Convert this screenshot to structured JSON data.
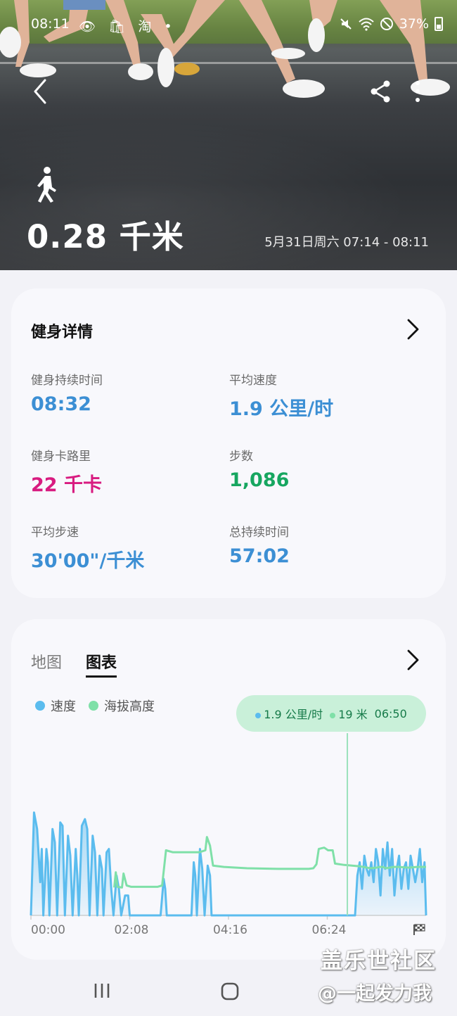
{
  "status_bar": {
    "time": "08:11",
    "left_icons": "👁 🛍 淘 •",
    "battery_text": "37%"
  },
  "hero": {
    "distance": "0.28 千米",
    "date_range": "5月31日周六 07:14 - 08:11"
  },
  "details": {
    "title": "健身详情",
    "metrics": [
      {
        "label": "健身持续时间",
        "value": "08:32"
      },
      {
        "label": "平均速度",
        "value": "1.9 公里/时"
      },
      {
        "label": "健身卡路里",
        "value": "22 千卡"
      },
      {
        "label": "步数",
        "value": "1,086"
      },
      {
        "label": "平均步速",
        "value": "30'00\"/千米"
      },
      {
        "label": "总持续时间",
        "value": "57:02"
      }
    ]
  },
  "chart_card": {
    "tabs": [
      {
        "label": "地图",
        "active": false
      },
      {
        "label": "图表",
        "active": true
      }
    ],
    "legend": [
      {
        "label": "速度",
        "color": "#5bbcee"
      },
      {
        "label": "海拔高度",
        "color": "#7fe0a8"
      }
    ],
    "tooltip": {
      "speed": "1.9 公里/时",
      "altitude": "19 米",
      "time": "06:50"
    }
  },
  "chart_data": {
    "type": "line",
    "x_ticks": [
      "00:00",
      "02:08",
      "04:16",
      "06:24"
    ],
    "x_range_seconds": [
      0,
      512
    ],
    "series": [
      {
        "name": "速度",
        "color": "#5bbcee",
        "points": [
          [
            0,
            0
          ],
          [
            4,
            1.55
          ],
          [
            8,
            1.3
          ],
          [
            12,
            0.5
          ],
          [
            14,
            1.0
          ],
          [
            16,
            0
          ],
          [
            20,
            1.0
          ],
          [
            22,
            0.8
          ],
          [
            24,
            0
          ],
          [
            28,
            1.3
          ],
          [
            31,
            1.1
          ],
          [
            34,
            0
          ],
          [
            38,
            1.4
          ],
          [
            41,
            1.35
          ],
          [
            44,
            0
          ],
          [
            48,
            1.2
          ],
          [
            51,
            0.9
          ],
          [
            54,
            0
          ],
          [
            58,
            1.0
          ],
          [
            60,
            0.6
          ],
          [
            62,
            0
          ],
          [
            66,
            1.35
          ],
          [
            70,
            1.45
          ],
          [
            73,
            1.3
          ],
          [
            76,
            0
          ],
          [
            80,
            1.2
          ],
          [
            83,
            0.95
          ],
          [
            86,
            0
          ],
          [
            89,
            0.9
          ],
          [
            92,
            0.7
          ],
          [
            94,
            0
          ],
          [
            98,
            0.95
          ],
          [
            101,
            1.0
          ],
          [
            104,
            0.4
          ],
          [
            107,
            0
          ],
          [
            111,
            0.6
          ],
          [
            114,
            0.4
          ],
          [
            117,
            0
          ],
          [
            122,
            0.3
          ],
          [
            126,
            0.3
          ],
          [
            128,
            0
          ],
          [
            168,
            0
          ],
          [
            172,
            0.55
          ],
          [
            174,
            0.4
          ],
          [
            176,
            0
          ],
          [
            208,
            0
          ],
          [
            211,
            0.8
          ],
          [
            213,
            0.6
          ],
          [
            215,
            0
          ],
          [
            219,
            1.0
          ],
          [
            222,
            0.7
          ],
          [
            225,
            0
          ],
          [
            229,
            0.75
          ],
          [
            232,
            0.6
          ],
          [
            234,
            0
          ],
          [
            420,
            0
          ],
          [
            423,
            0.6
          ],
          [
            426,
            0.8
          ],
          [
            429,
            0.4
          ],
          [
            432,
            0.9
          ],
          [
            435,
            0.7
          ],
          [
            438,
            0.6
          ],
          [
            441,
            0.8
          ],
          [
            444,
            0.5
          ],
          [
            447,
            1.0
          ],
          [
            450,
            0.8
          ],
          [
            453,
            0.3
          ],
          [
            456,
            1.0
          ],
          [
            459,
            0.7
          ],
          [
            462,
            1.1
          ],
          [
            465,
            0.6
          ],
          [
            468,
            1.0
          ],
          [
            471,
            0.3
          ],
          [
            474,
            0.7
          ],
          [
            477,
            0.9
          ],
          [
            480,
            0.4
          ],
          [
            483,
            0.7
          ],
          [
            486,
            0.8
          ],
          [
            489,
            0.4
          ],
          [
            492,
            0.9
          ],
          [
            495,
            0.7
          ],
          [
            498,
            0.5
          ],
          [
            501,
            0.7
          ],
          [
            504,
            1.0
          ],
          [
            507,
            0.5
          ],
          [
            510,
            0.8
          ],
          [
            512,
            0
          ]
        ]
      },
      {
        "name": "海拔高度",
        "color": "#7fe0a8",
        "points": [
          [
            108,
            0.42
          ],
          [
            110,
            0.65
          ],
          [
            112,
            0.43
          ],
          [
            118,
            0.42
          ],
          [
            120,
            0.63
          ],
          [
            124,
            0.45
          ],
          [
            130,
            0.43
          ],
          [
            164,
            0.43
          ],
          [
            170,
            0.45
          ],
          [
            175,
            0.98
          ],
          [
            184,
            0.95
          ],
          [
            200,
            0.95
          ],
          [
            218,
            0.95
          ],
          [
            226,
            0.98
          ],
          [
            228,
            1.18
          ],
          [
            232,
            1.05
          ],
          [
            236,
            0.75
          ],
          [
            250,
            0.73
          ],
          [
            280,
            0.71
          ],
          [
            320,
            0.7
          ],
          [
            360,
            0.7
          ],
          [
            366,
            0.71
          ],
          [
            370,
            0.77
          ],
          [
            373,
            1.0
          ],
          [
            380,
            1.02
          ],
          [
            385,
            0.98
          ],
          [
            391,
            0.98
          ],
          [
            394,
            0.78
          ],
          [
            406,
            0.76
          ],
          [
            426,
            0.74
          ],
          [
            440,
            0.71
          ],
          [
            448,
            0.72
          ],
          [
            452,
            0.73
          ],
          [
            456,
            0.73
          ],
          [
            460,
            0.71
          ],
          [
            470,
            0.73
          ],
          [
            476,
            0.73
          ],
          [
            490,
            0.72
          ],
          [
            500,
            0.73
          ],
          [
            512,
            0.73
          ]
        ]
      }
    ]
  },
  "watermark": {
    "line1": "盖乐世社区",
    "line2": "@一起发力我"
  }
}
